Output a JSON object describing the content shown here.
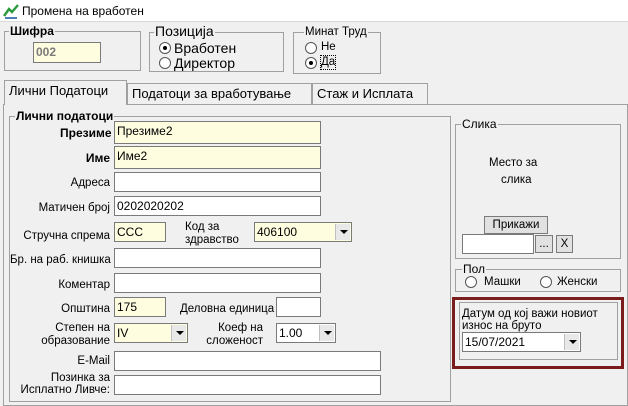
{
  "window": {
    "title": "Промена на вработен"
  },
  "header": {
    "sifra_label": "Шифра",
    "sifra_value": "002",
    "pozicija_label": "Позиција",
    "pozicija_options": [
      "Вработен",
      "Директор"
    ],
    "pozicija_selected": "Вработен",
    "minat_trud_label": "Минат Труд",
    "minat_trud_options": [
      "Не",
      "Да"
    ],
    "minat_trud_selected": "Да"
  },
  "tabs": [
    "Лични Податоци",
    "Податоци за вработување",
    "Стаж и Исплата"
  ],
  "active_tab": "Лични Податоци",
  "personal": {
    "group_label": "Лични податоци",
    "prezime_label": "Презиме",
    "prezime_value": "Презиме2",
    "ime_label": "Име",
    "ime_value": "Име2",
    "adresa_label": "Адреса",
    "adresa_value": "",
    "maticen_label": "Матичен број",
    "maticen_value": "0202020202",
    "strucna_label": "Стручна спрема",
    "strucna_value": "ССС",
    "kod_label_1": "Код за",
    "kod_label_2": "здравство",
    "kod_value": "406100",
    "kniska_label": "Бр. на раб. книшка",
    "kniska_value": "",
    "komentar_label": "Коментар",
    "komentar_value": "",
    "opstina_label": "Општина",
    "opstina_value": "175",
    "delovna_label": "Деловна единица",
    "delovna_value": "",
    "stepen_label_1": "Степен на",
    "stepen_label_2": "образование",
    "stepen_value": "IV",
    "koef_label_1": "Коеф на",
    "koef_label_2": "сложеност",
    "koef_value": "1.00",
    "email_label": "E-Mail",
    "email_value": "",
    "pozinka_label_1": "Позинка за",
    "pozinka_label_2": "Исплатно Ливче:",
    "pozinka_value": ""
  },
  "slika": {
    "group_label": "Слика",
    "placeholder_1": "Место за",
    "placeholder_2": "слика",
    "prikazi_label": "Прикажи",
    "browse_label": "...",
    "clear_label": "X"
  },
  "pol": {
    "group_label": "Пол",
    "options": [
      "Машки",
      "Женски"
    ]
  },
  "datum": {
    "label_1": "Датум од кој важи новиот",
    "label_2": "износ на бруто",
    "value": "15/07/2021"
  },
  "colors": {
    "highlight": "#7a1c1c",
    "yellow_field": "#fffde0"
  }
}
